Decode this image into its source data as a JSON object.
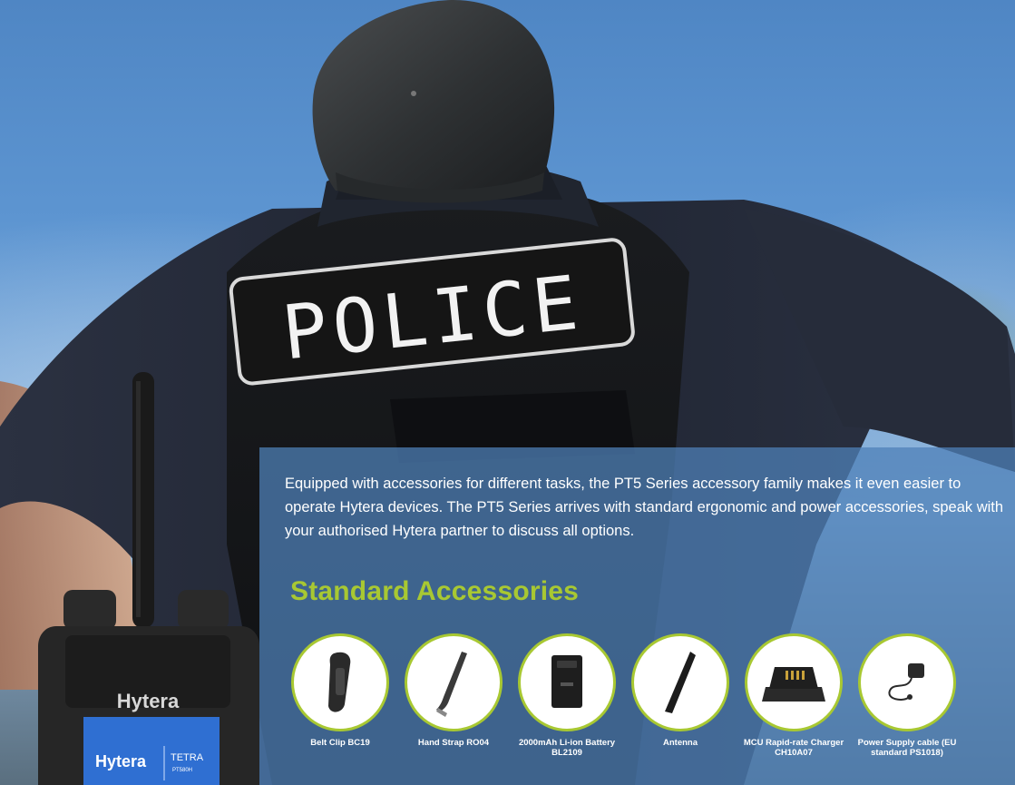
{
  "hero": {
    "patch_text": "POLICE",
    "radio_brand": "Hytera",
    "radio_screen_brand": "Hytera",
    "radio_screen_tetra": "TETRA",
    "radio_screen_model": "PT580H"
  },
  "colors": {
    "accent": "#a8c832",
    "panel": "#4e80b8",
    "text": "#ffffff"
  },
  "intro": {
    "text": "Equipped with accessories for different tasks, the PT5 Series accessory family makes it even easier to operate Hytera devices. The PT5 Series arrives with standard ergonomic and power accessories, speak with your authorised Hytera partner to discuss all options."
  },
  "section": {
    "title": "Standard Accessories"
  },
  "accessories": [
    {
      "label": "Belt Clip BC19",
      "icon": "belt-clip-icon"
    },
    {
      "label": "Hand Strap RO04",
      "icon": "hand-strap-icon"
    },
    {
      "label": "2000mAh Li-ion Battery BL2109",
      "icon": "battery-icon"
    },
    {
      "label": "Antenna",
      "icon": "antenna-icon"
    },
    {
      "label": "MCU Rapid-rate Charger CH10A07",
      "icon": "charger-icon"
    },
    {
      "label": "Power Supply cable (EU standard PS1018)",
      "icon": "power-cable-icon"
    }
  ]
}
